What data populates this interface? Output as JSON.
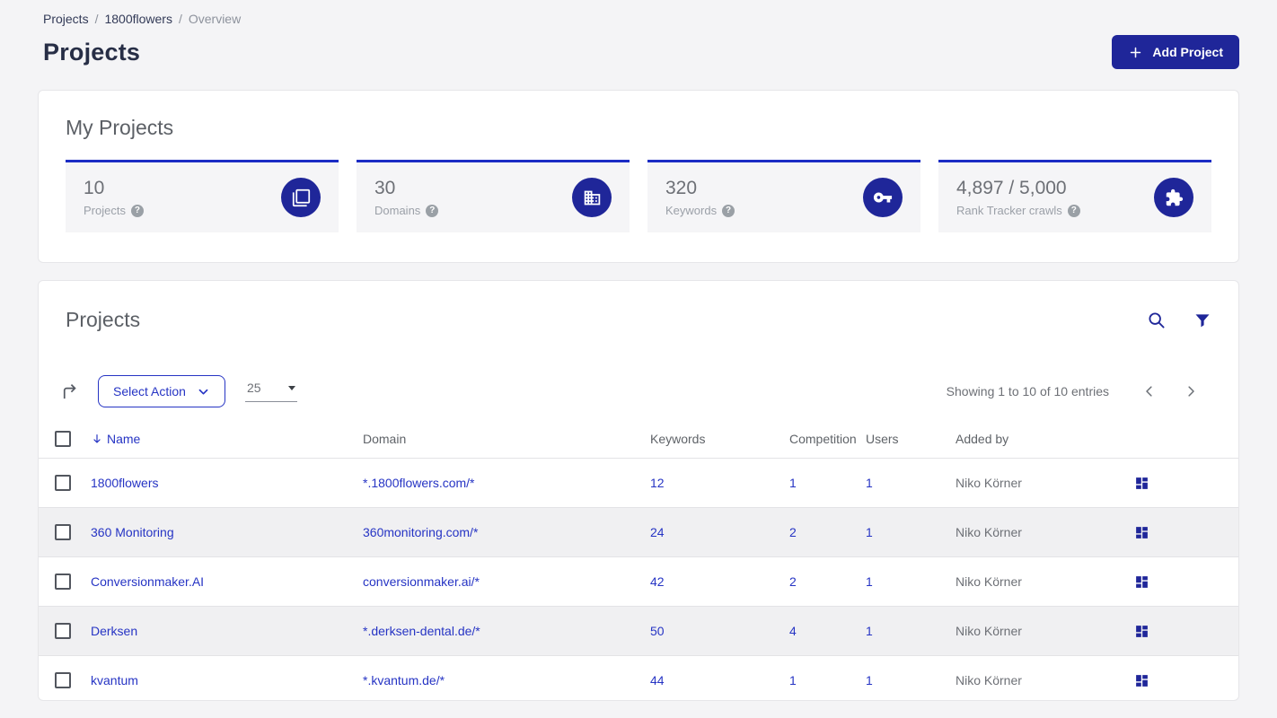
{
  "colors": {
    "primary_blue": "#1f2699",
    "link_blue": "#2634c4",
    "stat_border_blue": "#1b2cc4",
    "page_background": "#f4f4f6",
    "alt_row_background": "#f0f0f2"
  },
  "breadcrumb": {
    "separator": "/",
    "items": [
      {
        "label": "Projects"
      },
      {
        "label": "1800flowers"
      },
      {
        "label": "Overview"
      }
    ]
  },
  "header": {
    "title": "Projects",
    "add_project_label": "Add Project"
  },
  "my_projects": {
    "title": "My Projects",
    "help_glyph": "?",
    "stats": [
      {
        "value": "10",
        "label": "Projects",
        "icon": "projects-stat-icon"
      },
      {
        "value": "30",
        "label": "Domains",
        "icon": "domains-stat-icon"
      },
      {
        "value": "320",
        "label": "Keywords",
        "icon": "keywords-stat-icon"
      },
      {
        "value": "4,897 / 5,000",
        "label": "Rank Tracker crawls",
        "icon": "crawls-stat-icon"
      }
    ]
  },
  "projects_panel": {
    "title": "Projects",
    "icons": [
      "search-icon",
      "filter-icon"
    ],
    "toolbar": {
      "export_icon": "export-arrow-icon",
      "select_action_label": "Select Action",
      "page_size_value": "25",
      "showing_text": "Showing 1 to 10 of 10 entries"
    },
    "table": {
      "columns": {
        "name": "Name",
        "domain": "Domain",
        "keywords": "Keywords",
        "competition": "Competition",
        "users": "Users",
        "added_by": "Added by"
      },
      "sorted_column": "name",
      "row_action_icon": "dashboard-icon",
      "rows": [
        {
          "name": "1800flowers",
          "domain": "*.1800flowers.com/*",
          "keywords": "12",
          "competition": "1",
          "users": "1",
          "added_by": "Niko Körner"
        },
        {
          "name": "360 Monitoring",
          "domain": "360monitoring.com/*",
          "keywords": "24",
          "competition": "2",
          "users": "1",
          "added_by": "Niko Körner"
        },
        {
          "name": "Conversionmaker.AI",
          "domain": "conversionmaker.ai/*",
          "keywords": "42",
          "competition": "2",
          "users": "1",
          "added_by": "Niko Körner"
        },
        {
          "name": "Derksen",
          "domain": "*.derksen-dental.de/*",
          "keywords": "50",
          "competition": "4",
          "users": "1",
          "added_by": "Niko Körner"
        },
        {
          "name": "kvantum",
          "domain": "*.kvantum.de/*",
          "keywords": "44",
          "competition": "1",
          "users": "1",
          "added_by": "Niko Körner"
        }
      ]
    }
  }
}
